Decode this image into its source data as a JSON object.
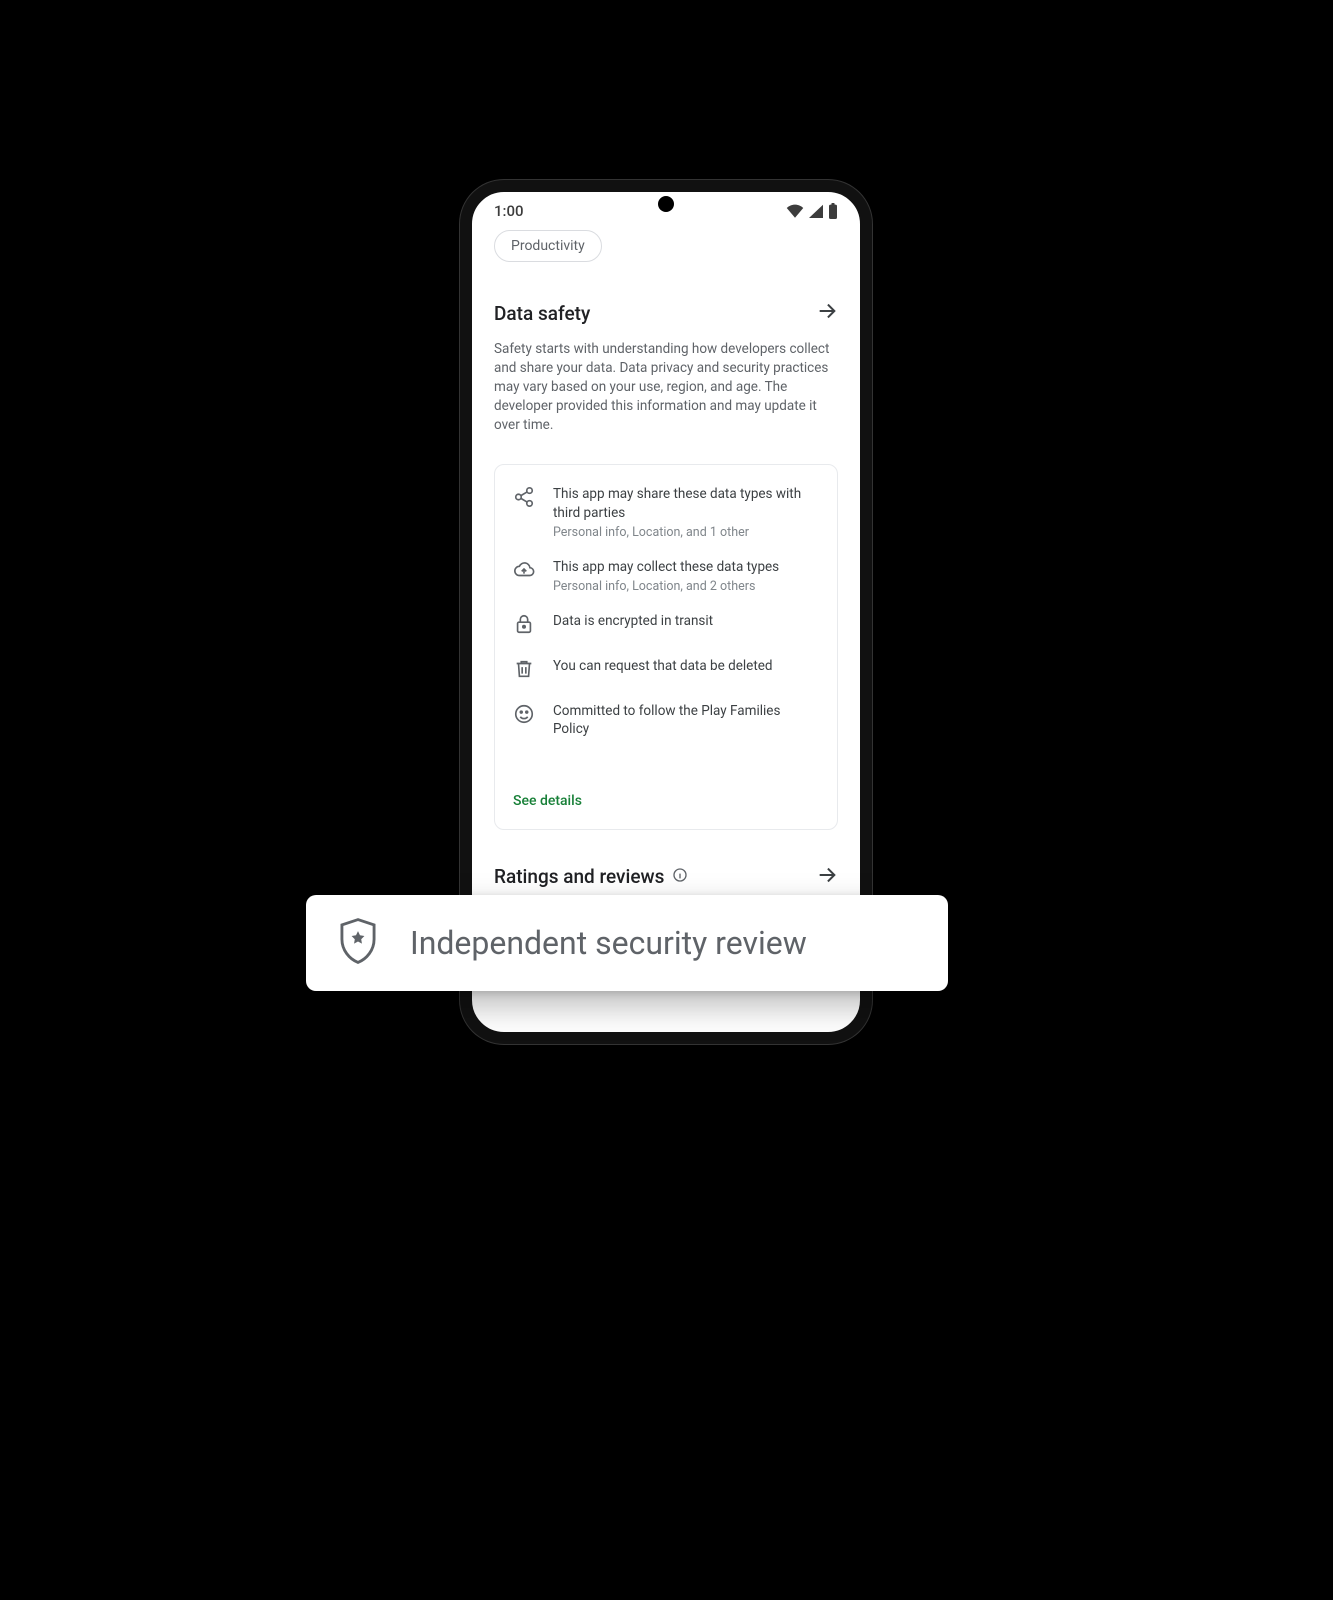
{
  "status": {
    "time": "1:00"
  },
  "chip": {
    "label": "Productivity"
  },
  "data_safety": {
    "title": "Data safety",
    "desc": "Safety starts with understanding how developers collect and share your data. Data privacy and security practices may vary based on your use, region, and age. The developer provided this information and may update it over time.",
    "items": [
      {
        "icon": "share-icon",
        "title": "This app may share these data types with third parties",
        "sub": "Personal info, Location, and 1 other"
      },
      {
        "icon": "cloud-upload-icon",
        "title": "This app may collect these data types",
        "sub": "Personal info, Location, and 2 others"
      },
      {
        "icon": "lock-icon",
        "title": "Data is encrypted in transit",
        "sub": ""
      },
      {
        "icon": "trash-icon",
        "title": "You can request that data be deleted",
        "sub": ""
      },
      {
        "icon": "smiley-icon",
        "title": "Committed to follow the Play Families Policy",
        "sub": ""
      }
    ],
    "see_details": "See details"
  },
  "ratings": {
    "title": "Ratings and reviews"
  },
  "callout": {
    "label": "Independent security review"
  }
}
